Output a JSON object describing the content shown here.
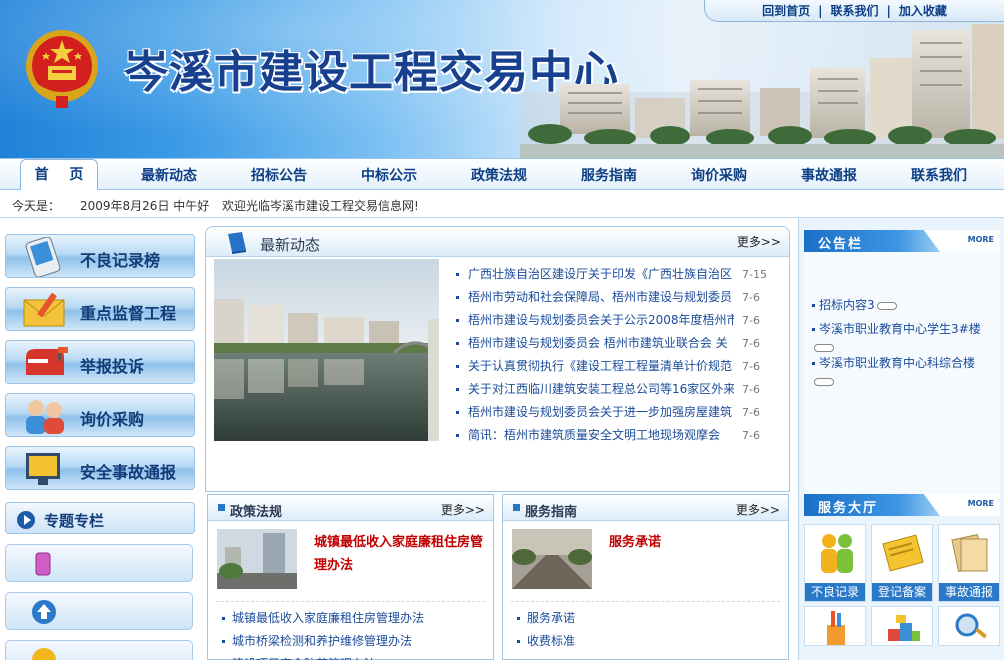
{
  "header": {
    "site_title": "岑溪市建设工程交易中心",
    "links": [
      "回到首页",
      "联系我们",
      "加入收藏"
    ]
  },
  "nav": {
    "tabs": [
      "首 页",
      "最新动态",
      "招标公告",
      "中标公示",
      "政策法规",
      "服务指南",
      "询价采购",
      "事故通报",
      "联系我们"
    ],
    "active": "首 页"
  },
  "infobar": {
    "today_label": "今天是：",
    "date": "2009年8月26日  中午好",
    "welcome": "欢迎光临岑溪市建设工程交易信息网!"
  },
  "left": {
    "buttons": [
      "不良记录榜",
      "重点监督工程",
      "举报投诉",
      "询价采购",
      "安全事故通报"
    ],
    "topic_title": "专题专栏"
  },
  "news": {
    "title": "最新动态",
    "more": "更多>>",
    "items": [
      {
        "text": "广西壮族自治区建设厅关于印发《广西壮族自治区",
        "date": "7-15"
      },
      {
        "text": "梧州市劳动和社会保障局、梧州市建设与规划委员",
        "date": "7-6"
      },
      {
        "text": "梧州市建设与规划委员会关于公示2008年度梧州市",
        "date": "7-6"
      },
      {
        "text": "梧州市建设与规划委员会 梧州市建筑业联合会 关",
        "date": "7-6"
      },
      {
        "text": "关于认真贯彻执行《建设工程工程量清单计价规范",
        "date": "7-6"
      },
      {
        "text": "关于对江西临川建筑安装工程总公司等16家区外来",
        "date": "7-6"
      },
      {
        "text": "梧州市建设与规划委员会关于进一步加强房屋建筑",
        "date": "7-6"
      },
      {
        "text": "简讯：梧州市建筑质量安全文明工地现场观摩会",
        "date": "7-6"
      }
    ]
  },
  "policy": {
    "title": "政策法规",
    "more": "更多>>",
    "feature": "城镇最低收入家庭廉租住房管理办法",
    "items": [
      "城镇最低收入家庭廉租住房管理办法",
      "城市桥梁检测和养护维修管理办法",
      "建设项目安全防范管理办法"
    ]
  },
  "service": {
    "title": "服务指南",
    "more": "更多>>",
    "feature": "服务承诺",
    "items": [
      "服务承诺",
      "收费标准"
    ]
  },
  "notice": {
    "title": "公告栏",
    "more": "MORE",
    "items": [
      "招标内容3",
      "岑溪市职业教育中心学生3#楼",
      "岑溪市职业教育中心科综合楼"
    ]
  },
  "hall": {
    "title": "服务大厅",
    "more": "MORE",
    "items": [
      "不良记录",
      "登记备案",
      "事故通报"
    ]
  },
  "colors": {
    "brand_blue": "#17418f",
    "link_blue": "#1a4b9a",
    "feature_red": "#c00000",
    "panel_border": "#a3c8e7"
  }
}
